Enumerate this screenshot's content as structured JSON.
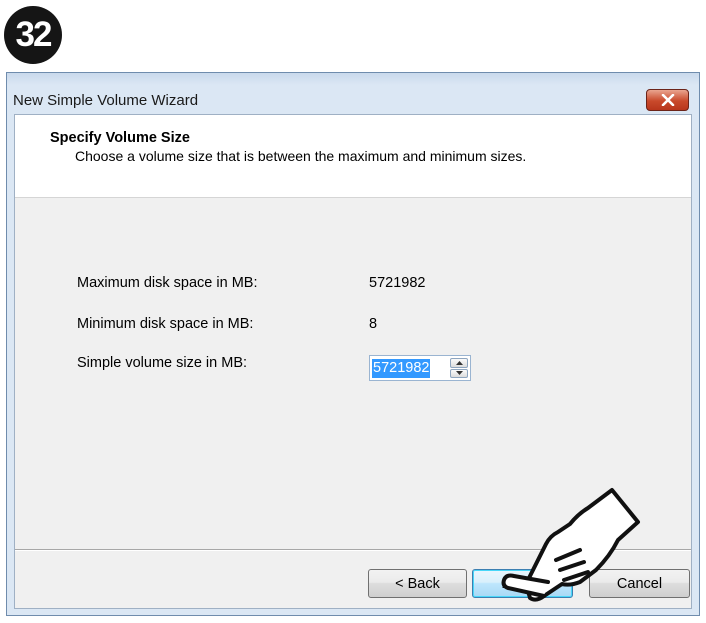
{
  "step_badge": "32",
  "window": {
    "title": "New Simple Volume Wizard"
  },
  "header": {
    "title": "Specify Volume Size",
    "subtitle": "Choose a volume size that is between the maximum and minimum sizes."
  },
  "fields": {
    "max_label": "Maximum disk space in MB:",
    "max_value": "5721982",
    "min_label": "Minimum disk space in MB:",
    "min_value": "8",
    "size_label": "Simple volume size in MB:",
    "size_value": "5721982"
  },
  "buttons": {
    "back": "< Back",
    "next": "Next >",
    "cancel": "Cancel"
  },
  "icons": {
    "close": "close-icon",
    "spin_up": "up-arrow-icon",
    "spin_down": "down-arrow-icon",
    "pointer": "hand-pointer-icon"
  },
  "colors": {
    "selection": "#3399ff",
    "close_button": "#c9492b",
    "window_frame": "#dbe7f4",
    "default_button": "#bee6fd"
  }
}
